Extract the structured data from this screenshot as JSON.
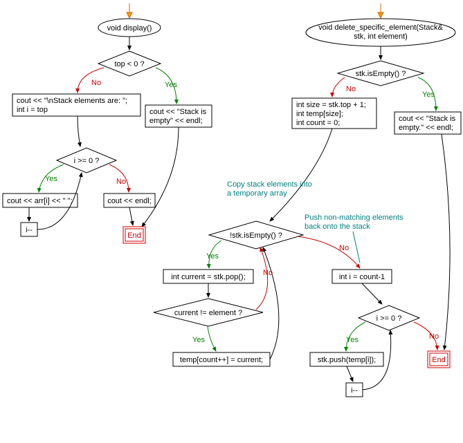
{
  "chart_data": {
    "type": "diagram",
    "flowcharts": [
      {
        "name": "display",
        "start": "d_start"
      },
      {
        "name": "delete_specific_element",
        "start": "r_start"
      }
    ],
    "annotations": {
      "copy": "Copy stack elements into\na temporary array",
      "push": "Push non-matching elements\nback onto the stack"
    },
    "labels": {
      "yes": "Yes",
      "no": "No"
    },
    "nodes": {
      "d_start": {
        "kind": "start",
        "text": "void display()"
      },
      "d_cond_top": {
        "kind": "decision",
        "text": "top < 0 ?"
      },
      "d_empty": {
        "kind": "process",
        "text": "cout << \"Stack is\nempty\" << endl;"
      },
      "d_header": {
        "kind": "process",
        "text": "cout << \"\\nStack elements are: \";\nint i = top"
      },
      "d_cond_i": {
        "kind": "decision",
        "text": "i >= 0 ?"
      },
      "d_print": {
        "kind": "process",
        "text": "cout << arr[i] << \" \";"
      },
      "d_dec": {
        "kind": "process",
        "text": "i--"
      },
      "d_endl": {
        "kind": "process",
        "text": "cout << endl;"
      },
      "d_end": {
        "kind": "end",
        "text": "End"
      },
      "r_start": {
        "kind": "start",
        "text": "void delete_specific_element(Stack&\nstk, int element)"
      },
      "r_cond_empty": {
        "kind": "decision",
        "text": "stk.isEmpty() ?"
      },
      "r_empty": {
        "kind": "process",
        "text": "cout << \"Stack is\nempty.\" << endl;"
      },
      "r_init": {
        "kind": "process",
        "text": "int size = stk.top + 1;\nint temp[size];\nint count = 0;"
      },
      "r_cond_loop1": {
        "kind": "decision",
        "text": "!stk.isEmpty() ?"
      },
      "r_pop": {
        "kind": "process",
        "text": "int current = stk.pop();"
      },
      "r_cond_match": {
        "kind": "decision",
        "text": "current != element ?"
      },
      "r_store": {
        "kind": "process",
        "text": "temp[count++] = current;"
      },
      "r_init_i": {
        "kind": "process",
        "text": "int i = count-1"
      },
      "r_cond_i": {
        "kind": "decision",
        "text": "i >= 0 ?"
      },
      "r_push": {
        "kind": "process",
        "text": "stk.push(temp[i]);"
      },
      "r_dec": {
        "kind": "process",
        "text": "i--"
      },
      "r_end": {
        "kind": "end",
        "text": "End"
      }
    }
  }
}
